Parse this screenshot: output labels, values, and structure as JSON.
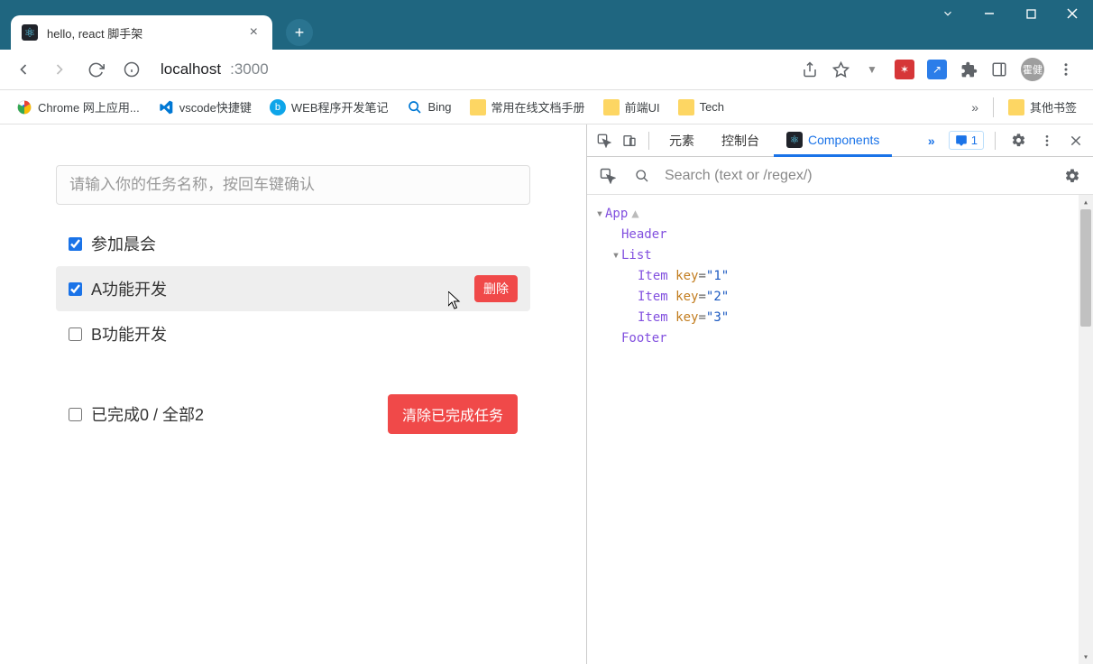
{
  "browser": {
    "tab_title": "hello, react 脚手架",
    "url_host": "localhost",
    "url_port": ":3000",
    "avatar_text": "霍健"
  },
  "bookmarks": {
    "b0": "Chrome 网上应用...",
    "b1": "vscode快捷键",
    "b2": "WEB程序开发笔记",
    "b3": "Bing",
    "b4": "常用在线文档手册",
    "b5": "前端UI",
    "b6": "Tech",
    "other": "其他书签",
    "more": "»"
  },
  "app": {
    "input_placeholder": "请输入你的任务名称，按回车键确认",
    "tasks": [
      {
        "label": "参加晨会",
        "checked": true,
        "hovered": false
      },
      {
        "label": "A功能开发",
        "checked": true,
        "hovered": true
      },
      {
        "label": "B功能开发",
        "checked": false,
        "hovered": false
      }
    ],
    "delete_label": "删除",
    "footer_label": "已完成0 / 全部2",
    "clear_label": "清除已完成任务"
  },
  "devtools": {
    "tab_elements": "元素",
    "tab_console": "控制台",
    "tab_components": "Components",
    "more": "»",
    "msg_count": "1",
    "search_placeholder": "Search (text or /regex/)",
    "tree": {
      "app": "App",
      "header": "Header",
      "list": "List",
      "item": "Item",
      "key": "key",
      "k1": "\"1\"",
      "k2": "\"2\"",
      "k3": "\"3\"",
      "footer": "Footer"
    }
  }
}
